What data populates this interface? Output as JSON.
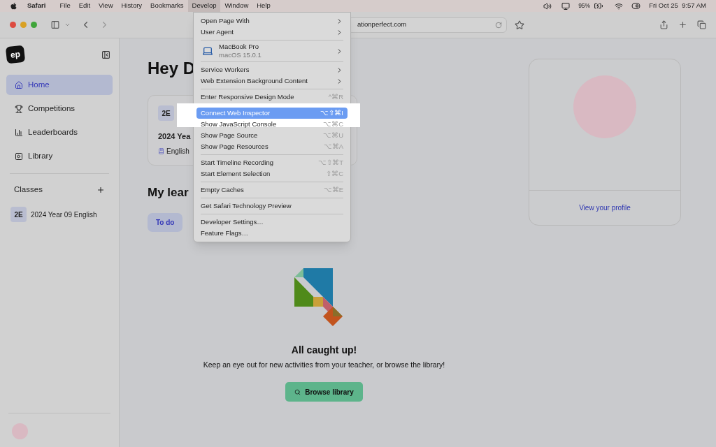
{
  "menubar": {
    "app": "Safari",
    "menus": [
      {
        "label": "File",
        "selected": false
      },
      {
        "label": "Edit",
        "selected": false
      },
      {
        "label": "View",
        "selected": false
      },
      {
        "label": "History",
        "selected": false
      },
      {
        "label": "Bookmarks",
        "selected": false
      },
      {
        "label": "Develop",
        "selected": true
      },
      {
        "label": "Window",
        "selected": false
      },
      {
        "label": "Help",
        "selected": false
      }
    ],
    "battery": "95%",
    "clock": "Fri Oct 25  9:57 AM"
  },
  "toolbar": {
    "url": "ationperfect.com"
  },
  "develop_menu": [
    {
      "kind": "item",
      "label": "Open Page With",
      "submenu": true,
      "selected": false
    },
    {
      "kind": "item",
      "label": "User Agent",
      "submenu": true,
      "selected": false
    },
    {
      "kind": "separator"
    },
    {
      "kind": "device",
      "label": "MacBook Pro",
      "detail": "macOS 15.0.1",
      "submenu": true,
      "selected": false
    },
    {
      "kind": "separator"
    },
    {
      "kind": "item",
      "label": "Service Workers",
      "submenu": true,
      "selected": false
    },
    {
      "kind": "item",
      "label": "Web Extension Background Content",
      "submenu": true,
      "selected": false
    },
    {
      "kind": "separator"
    },
    {
      "kind": "item",
      "label": "Enter Responsive Design Mode",
      "shortcut": "^⌘R",
      "selected": false
    },
    {
      "kind": "separator"
    },
    {
      "kind": "item",
      "label": "Connect Web Inspector",
      "shortcut": "⌥⇧⌘I",
      "selected": true
    },
    {
      "kind": "item",
      "label": "Show JavaScript Console",
      "shortcut": "⌥⌘C",
      "selected": false
    },
    {
      "kind": "item",
      "label": "Show Page Source",
      "shortcut": "⌥⌘U",
      "selected": false
    },
    {
      "kind": "item",
      "label": "Show Page Resources",
      "shortcut": "⌥⌘A",
      "selected": false
    },
    {
      "kind": "separator"
    },
    {
      "kind": "item",
      "label": "Start Timeline Recording",
      "shortcut": "⌥⇧⌘T",
      "selected": false
    },
    {
      "kind": "item",
      "label": "Start Element Selection",
      "shortcut": "⇧⌘C",
      "selected": false
    },
    {
      "kind": "separator"
    },
    {
      "kind": "item",
      "label": "Empty Caches",
      "shortcut": "⌥⌘E",
      "selected": false
    },
    {
      "kind": "separator"
    },
    {
      "kind": "item",
      "label": "Get Safari Technology Preview",
      "selected": false
    },
    {
      "kind": "separator"
    },
    {
      "kind": "item",
      "label": "Developer Settings…",
      "selected": false
    },
    {
      "kind": "item",
      "label": "Feature Flags…",
      "selected": false
    }
  ],
  "sidebar": {
    "logo": "ep",
    "items": [
      {
        "kind": "home",
        "label": "Home",
        "selected": true
      },
      {
        "kind": "trophy",
        "label": "Competitions",
        "selected": false
      },
      {
        "kind": "chart",
        "label": "Leaderboards",
        "selected": false
      },
      {
        "kind": "library",
        "label": "Library",
        "selected": false
      }
    ],
    "classes_heading": "Classes",
    "classes": [
      {
        "badge": "2E",
        "name": "2024 Year 09 English"
      }
    ]
  },
  "main": {
    "greeting": "Hey D",
    "class_card": {
      "badge": "2E",
      "title": "2024 Yea",
      "subject": "English"
    },
    "section_title": "My lear",
    "tabs": [
      {
        "label": "To do",
        "selected": true
      }
    ],
    "empty_title": "All caught up!",
    "empty_text": "Keep an eye out for new activities from your teacher, or browse the library!",
    "browse_button": "Browse library"
  },
  "profile": {
    "link": "View your profile"
  }
}
